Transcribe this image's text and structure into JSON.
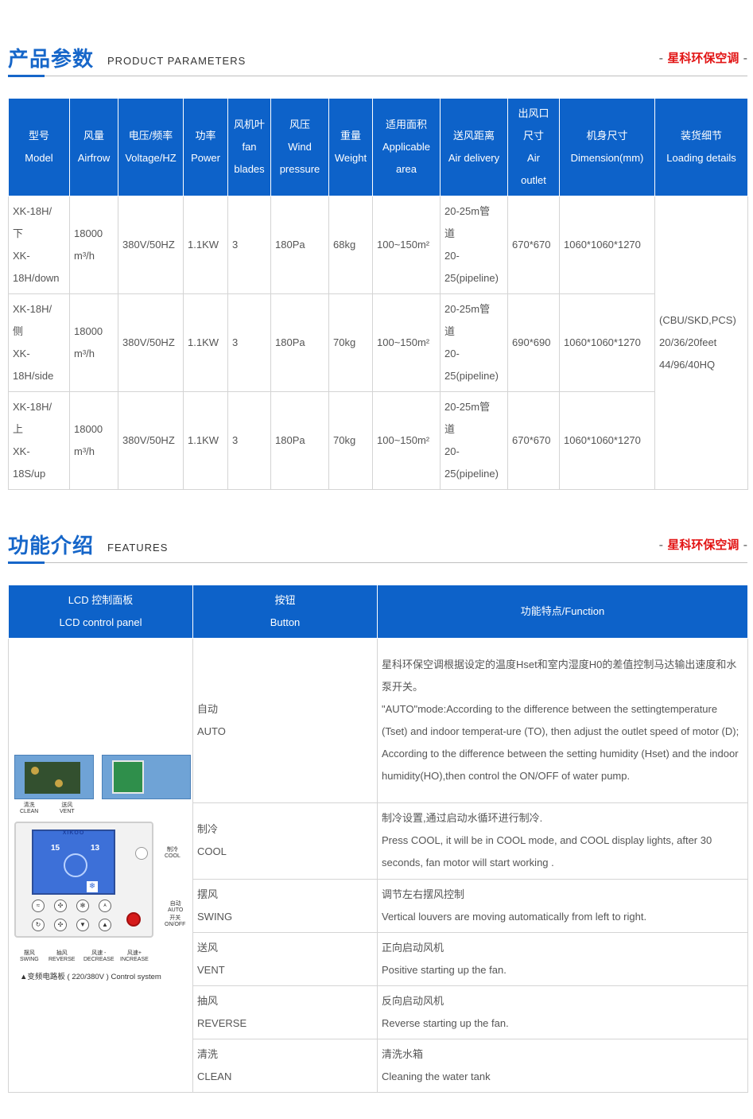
{
  "sections": {
    "params": {
      "title_cn": "产品参数",
      "title_en": "PRODUCT PARAMETERS",
      "brand": "星科环保空调"
    },
    "features": {
      "title_cn": "功能介绍",
      "title_en": "FEATURES",
      "brand": "星科环保空调"
    }
  },
  "brand_dash": "-",
  "params_table": {
    "headers": [
      [
        "型号",
        "Model"
      ],
      [
        "风量",
        "Airfrow"
      ],
      [
        "电压/频率",
        "Voltage/HZ"
      ],
      [
        "功率",
        "Power"
      ],
      [
        "风机叶",
        "fan",
        "blades"
      ],
      [
        "风压",
        "Wind",
        "pressure"
      ],
      [
        "重量",
        "Weight"
      ],
      [
        "适用面积",
        "Applicable",
        "area"
      ],
      [
        "送风距离",
        "Air delivery"
      ],
      [
        "出风口",
        "尺寸",
        "Air",
        "outlet"
      ],
      [
        "机身尺寸",
        "Dimension(mm)"
      ],
      [
        "装货细节",
        "Loading details"
      ]
    ],
    "rows": [
      {
        "model": [
          "XK-18H/",
          "下",
          "XK-",
          "18H/down"
        ],
        "airflow": [
          "18000",
          "m³/h"
        ],
        "voltage": "380V/50HZ",
        "power": "1.1KW",
        "blades": "3",
        "pressure": "180Pa",
        "weight": "68kg",
        "area": "100~150m²",
        "delivery": [
          "20-25m管",
          "道",
          "20-",
          "25(pipeline)"
        ],
        "outlet": "670*670",
        "dimension": "1060*1060*1270"
      },
      {
        "model": [
          "XK-18H/",
          "侧",
          "XK-",
          "18H/side"
        ],
        "airflow": [
          "18000",
          "m³/h"
        ],
        "voltage": "380V/50HZ",
        "power": "1.1KW",
        "blades": "3",
        "pressure": "180Pa",
        "weight": "70kg",
        "area": "100~150m²",
        "delivery": [
          "20-25m管",
          "道",
          "20-",
          "25(pipeline)"
        ],
        "outlet": "690*690",
        "dimension": "1060*1060*1270"
      },
      {
        "model": [
          "XK-18H/",
          "上",
          "XK-",
          "18S/up"
        ],
        "airflow": [
          "18000",
          "m³/h"
        ],
        "voltage": "380V/50HZ",
        "power": "1.1KW",
        "blades": "3",
        "pressure": "180Pa",
        "weight": "70kg",
        "area": "100~150m²",
        "delivery": [
          "20-25m管",
          "道",
          "20-",
          "25(pipeline)"
        ],
        "outlet": "670*670",
        "dimension": "1060*1060*1270"
      }
    ],
    "loading": [
      "(CBU/SKD,PCS)",
      "20/36/20feet",
      "44/96/40HQ"
    ]
  },
  "features_table": {
    "headers": {
      "panel": [
        "LCD 控制面板",
        "LCD control panel"
      ],
      "button": [
        "按钮",
        "Button"
      ],
      "function": [
        "功能特点/Function"
      ]
    },
    "rows": [
      {
        "button": [
          "自动",
          "AUTO"
        ],
        "function": [
          "星科环保空调根据设定的温度Hset和室内湿度H0的差值控制马达输出速度和水泵开关。",
          "\"AUTO\"mode:According to the difference between the settingtemperature (Tset) and indoor temperat-ure (TO), then adjust the outlet speed of motor (D); According to the difference between the setting humidity (Hset) and the indoor humidity(HO),then control the ON/OFF of water pump."
        ]
      },
      {
        "button": [
          "制冷",
          "COOL"
        ],
        "function": [
          "制冷设置,通过启动水循环进行制冷.",
          "Press COOL, it will be in COOL mode, and COOL display lights, after 30 seconds, fan motor will start working ."
        ]
      },
      {
        "button": [
          "摆风",
          "SWING"
        ],
        "function": [
          "调节左右摆风控制",
          "Vertical louvers are moving automatically from left to right."
        ]
      },
      {
        "button": [
          "送风",
          "VENT"
        ],
        "function": [
          "正向启动风机",
          "Positive starting up the fan."
        ]
      },
      {
        "button": [
          "抽风",
          "REVERSE"
        ],
        "function": [
          "反向启动风机",
          "Reverse starting up the fan."
        ]
      },
      {
        "button": [
          "清洗",
          "CLEAN"
        ],
        "function": [
          "清洗水箱",
          "Cleaning the water tank"
        ]
      }
    ]
  },
  "panel_image": {
    "brand_logo": "XIKOO",
    "lcd_temp": "15",
    "lcd_humidity": "13",
    "labels": {
      "clean": [
        "清洗",
        "CLEAN"
      ],
      "vent": [
        "送风",
        "VENT"
      ],
      "cool": [
        "制冷",
        "COOL"
      ],
      "auto": [
        "自动",
        "AUTO"
      ],
      "onoff": [
        "开关",
        "ON/OFF"
      ],
      "swing": [
        "摆风",
        "SWING"
      ],
      "reverse": [
        "抽风",
        "REVERSE"
      ],
      "decrease": [
        "风速 -",
        "DECREASE"
      ],
      "increase": [
        "风速+",
        "INCREASE"
      ]
    },
    "caption": "▲变频电路板 ( 220/380V ) Control system"
  }
}
